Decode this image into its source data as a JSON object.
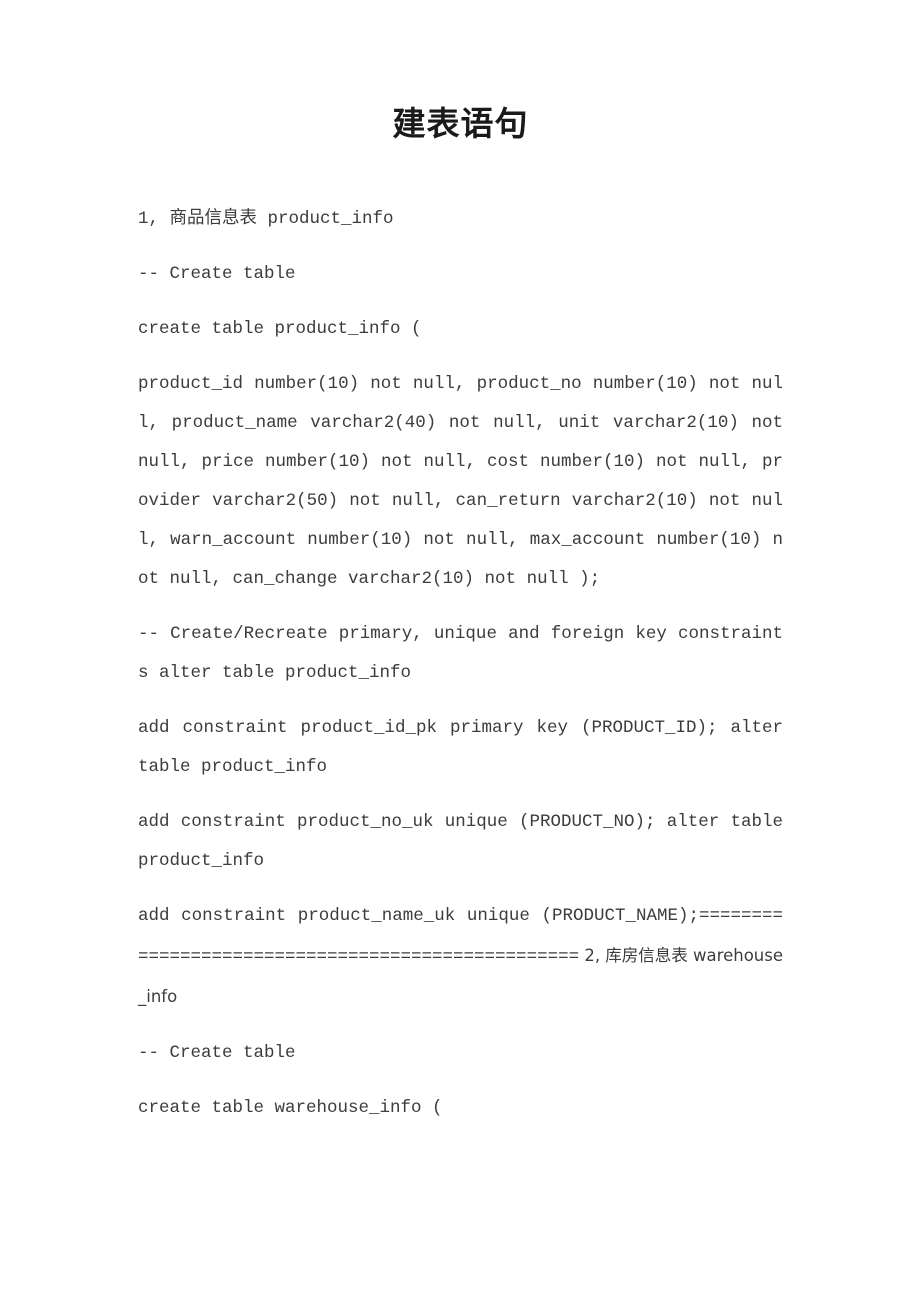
{
  "document": {
    "title": "建表语句",
    "page_background": "#ffffff",
    "text_color": "#3c3c3c",
    "title_color": "#1a1a1a"
  },
  "body": {
    "section_1_heading": "1, 商品信息表 product_info",
    "comment_create_table_1": "-- Create table",
    "create_table_open_1": "create table product_info (",
    "columns_block_1": "  product_id     number(10) not null,    product_no     number(10) not null,      product_name  varchar2(40)  not  null,       unit  varchar2(10) not null,    price           number(10) not null,   cost          number(10) not null,    provider      varchar2(50) not null,    can_return    varchar2(10) not null,    warn_account  number(10)  not  null,      max_account    number(10)  not  null,   can_change    varchar2(10) not null );",
    "comment_constraints": "-- Create/Recreate primary, unique and foreign key constraints alter table product_info",
    "constraint_pk": "  add constraint product_id_pk primary key (PRODUCT_ID); alter table product_info",
    "constraint_uk_no": "  add constraint product_no_uk unique (PRODUCT_NO); alter table product_info",
    "constraint_uk_name": "  add   constraint   product_name_uk   unique   (PRODUCT_NAME);",
    "separator": "==================================================",
    "section_2_heading": " 2, 库房信息表 warehouse_info",
    "comment_create_table_2": "-- Create table",
    "create_table_open_2": "create table warehouse_info ("
  }
}
